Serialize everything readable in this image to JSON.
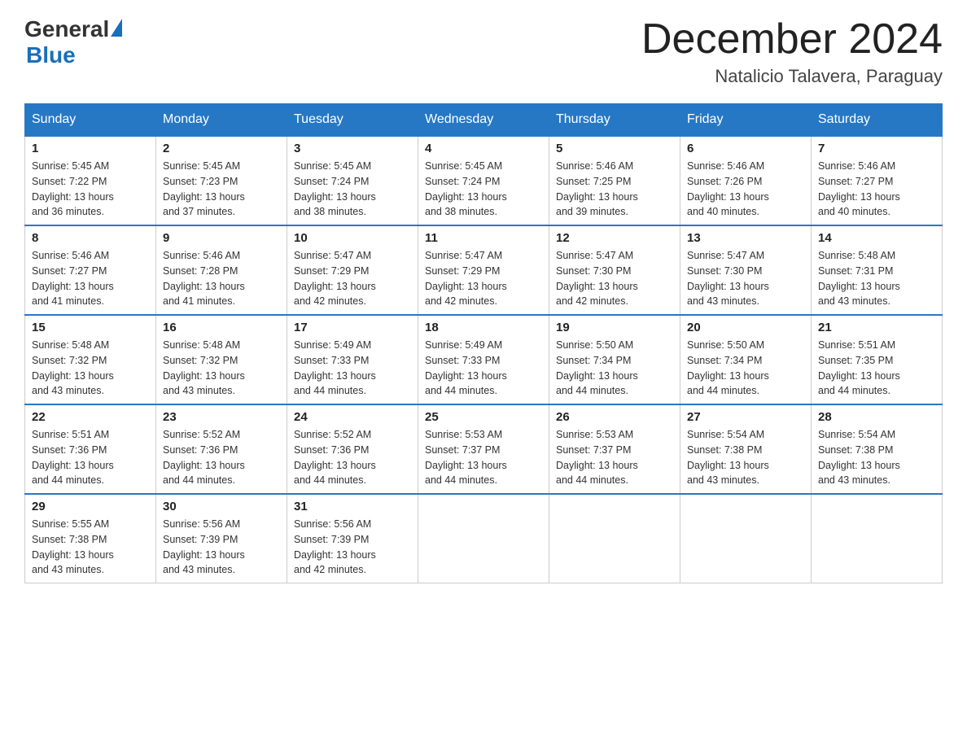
{
  "logo": {
    "general": "General",
    "blue": "Blue"
  },
  "title": {
    "month_year": "December 2024",
    "location": "Natalicio Talavera, Paraguay"
  },
  "headers": [
    "Sunday",
    "Monday",
    "Tuesday",
    "Wednesday",
    "Thursday",
    "Friday",
    "Saturday"
  ],
  "weeks": [
    [
      {
        "day": "1",
        "sunrise": "5:45 AM",
        "sunset": "7:22 PM",
        "daylight": "13 hours and 36 minutes."
      },
      {
        "day": "2",
        "sunrise": "5:45 AM",
        "sunset": "7:23 PM",
        "daylight": "13 hours and 37 minutes."
      },
      {
        "day": "3",
        "sunrise": "5:45 AM",
        "sunset": "7:24 PM",
        "daylight": "13 hours and 38 minutes."
      },
      {
        "day": "4",
        "sunrise": "5:45 AM",
        "sunset": "7:24 PM",
        "daylight": "13 hours and 38 minutes."
      },
      {
        "day": "5",
        "sunrise": "5:46 AM",
        "sunset": "7:25 PM",
        "daylight": "13 hours and 39 minutes."
      },
      {
        "day": "6",
        "sunrise": "5:46 AM",
        "sunset": "7:26 PM",
        "daylight": "13 hours and 40 minutes."
      },
      {
        "day": "7",
        "sunrise": "5:46 AM",
        "sunset": "7:27 PM",
        "daylight": "13 hours and 40 minutes."
      }
    ],
    [
      {
        "day": "8",
        "sunrise": "5:46 AM",
        "sunset": "7:27 PM",
        "daylight": "13 hours and 41 minutes."
      },
      {
        "day": "9",
        "sunrise": "5:46 AM",
        "sunset": "7:28 PM",
        "daylight": "13 hours and 41 minutes."
      },
      {
        "day": "10",
        "sunrise": "5:47 AM",
        "sunset": "7:29 PM",
        "daylight": "13 hours and 42 minutes."
      },
      {
        "day": "11",
        "sunrise": "5:47 AM",
        "sunset": "7:29 PM",
        "daylight": "13 hours and 42 minutes."
      },
      {
        "day": "12",
        "sunrise": "5:47 AM",
        "sunset": "7:30 PM",
        "daylight": "13 hours and 42 minutes."
      },
      {
        "day": "13",
        "sunrise": "5:47 AM",
        "sunset": "7:30 PM",
        "daylight": "13 hours and 43 minutes."
      },
      {
        "day": "14",
        "sunrise": "5:48 AM",
        "sunset": "7:31 PM",
        "daylight": "13 hours and 43 minutes."
      }
    ],
    [
      {
        "day": "15",
        "sunrise": "5:48 AM",
        "sunset": "7:32 PM",
        "daylight": "13 hours and 43 minutes."
      },
      {
        "day": "16",
        "sunrise": "5:48 AM",
        "sunset": "7:32 PM",
        "daylight": "13 hours and 43 minutes."
      },
      {
        "day": "17",
        "sunrise": "5:49 AM",
        "sunset": "7:33 PM",
        "daylight": "13 hours and 44 minutes."
      },
      {
        "day": "18",
        "sunrise": "5:49 AM",
        "sunset": "7:33 PM",
        "daylight": "13 hours and 44 minutes."
      },
      {
        "day": "19",
        "sunrise": "5:50 AM",
        "sunset": "7:34 PM",
        "daylight": "13 hours and 44 minutes."
      },
      {
        "day": "20",
        "sunrise": "5:50 AM",
        "sunset": "7:34 PM",
        "daylight": "13 hours and 44 minutes."
      },
      {
        "day": "21",
        "sunrise": "5:51 AM",
        "sunset": "7:35 PM",
        "daylight": "13 hours and 44 minutes."
      }
    ],
    [
      {
        "day": "22",
        "sunrise": "5:51 AM",
        "sunset": "7:36 PM",
        "daylight": "13 hours and 44 minutes."
      },
      {
        "day": "23",
        "sunrise": "5:52 AM",
        "sunset": "7:36 PM",
        "daylight": "13 hours and 44 minutes."
      },
      {
        "day": "24",
        "sunrise": "5:52 AM",
        "sunset": "7:36 PM",
        "daylight": "13 hours and 44 minutes."
      },
      {
        "day": "25",
        "sunrise": "5:53 AM",
        "sunset": "7:37 PM",
        "daylight": "13 hours and 44 minutes."
      },
      {
        "day": "26",
        "sunrise": "5:53 AM",
        "sunset": "7:37 PM",
        "daylight": "13 hours and 44 minutes."
      },
      {
        "day": "27",
        "sunrise": "5:54 AM",
        "sunset": "7:38 PM",
        "daylight": "13 hours and 43 minutes."
      },
      {
        "day": "28",
        "sunrise": "5:54 AM",
        "sunset": "7:38 PM",
        "daylight": "13 hours and 43 minutes."
      }
    ],
    [
      {
        "day": "29",
        "sunrise": "5:55 AM",
        "sunset": "7:38 PM",
        "daylight": "13 hours and 43 minutes."
      },
      {
        "day": "30",
        "sunrise": "5:56 AM",
        "sunset": "7:39 PM",
        "daylight": "13 hours and 43 minutes."
      },
      {
        "day": "31",
        "sunrise": "5:56 AM",
        "sunset": "7:39 PM",
        "daylight": "13 hours and 42 minutes."
      },
      null,
      null,
      null,
      null
    ]
  ],
  "labels": {
    "sunrise": "Sunrise:",
    "sunset": "Sunset:",
    "daylight": "Daylight:"
  }
}
